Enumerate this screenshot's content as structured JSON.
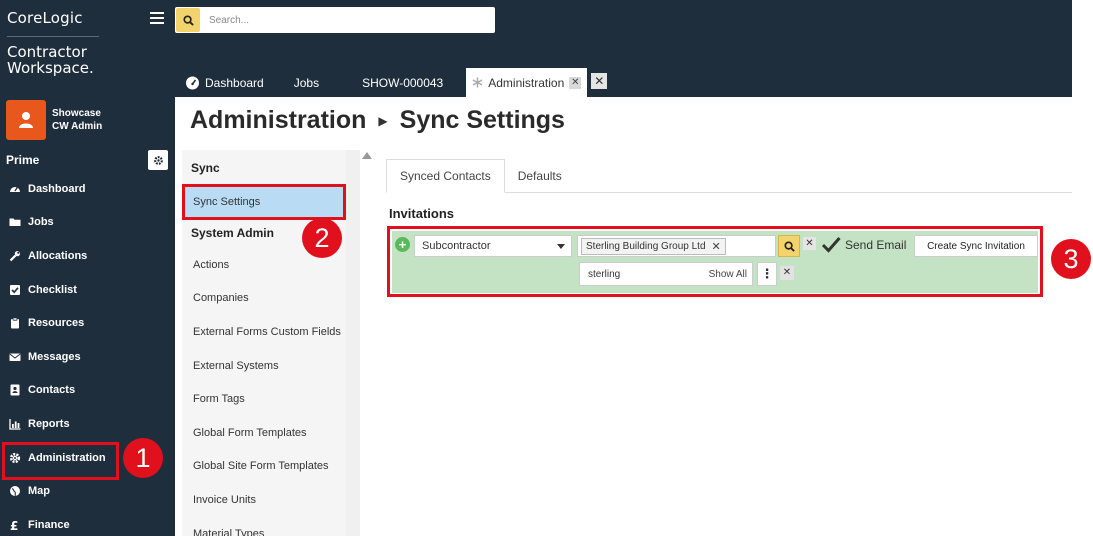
{
  "brand": {
    "line1": "CoreLogic",
    "line2": "Contractor",
    "line3": "Workspace."
  },
  "user": {
    "org": "Showcase",
    "role": "CW Admin"
  },
  "prime": {
    "label": "Prime"
  },
  "nav": [
    {
      "label": "Dashboard",
      "icon": "gauge-icon"
    },
    {
      "label": "Jobs",
      "icon": "folder-icon"
    },
    {
      "label": "Allocations",
      "icon": "wrench-icon"
    },
    {
      "label": "Checklist",
      "icon": "checkbox-icon"
    },
    {
      "label": "Resources",
      "icon": "clipboard-icon"
    },
    {
      "label": "Messages",
      "icon": "envelope-icon"
    },
    {
      "label": "Contacts",
      "icon": "contact-card-icon"
    },
    {
      "label": "Reports",
      "icon": "bar-chart-icon"
    },
    {
      "label": "Administration",
      "icon": "gear-icon"
    },
    {
      "label": "Map",
      "icon": "globe-icon"
    },
    {
      "label": "Finance",
      "icon": "pound-icon"
    }
  ],
  "search": {
    "placeholder": "Search..."
  },
  "tabs": [
    {
      "label": "Dashboard"
    },
    {
      "label": "Jobs"
    },
    {
      "label": "SHOW-000043"
    },
    {
      "label": "Administration"
    }
  ],
  "page": {
    "title": "Administration",
    "subtitle": "Sync Settings"
  },
  "admin_menu": {
    "sync_heading": "Sync",
    "sync_item": "Sync Settings",
    "system_heading": "System Admin",
    "items": [
      "Actions",
      "Companies",
      "External Forms Custom Fields",
      "External Systems",
      "Form Tags",
      "Global Form Templates",
      "Global Site Form Templates",
      "Invoice Units",
      "Material Types"
    ]
  },
  "content_tabs": [
    "Synced Contacts",
    "Defaults"
  ],
  "invitations": {
    "heading": "Invitations",
    "contact_type": "Subcontractor",
    "selected_company": "Sterling Building Group Ltd",
    "send_email_label": "Send Email",
    "create_button": "Create Sync Invitation",
    "filter_value": "sterling",
    "show_all_label": "Show All"
  },
  "badges": {
    "one": "1",
    "two": "2",
    "three": "3"
  },
  "colors": {
    "sidebar": "#1f2e3c",
    "highlight": "#e0101c",
    "accent": "#f3d36b",
    "selected": "#b9dcf4",
    "invite_row": "#c4e3c4"
  }
}
